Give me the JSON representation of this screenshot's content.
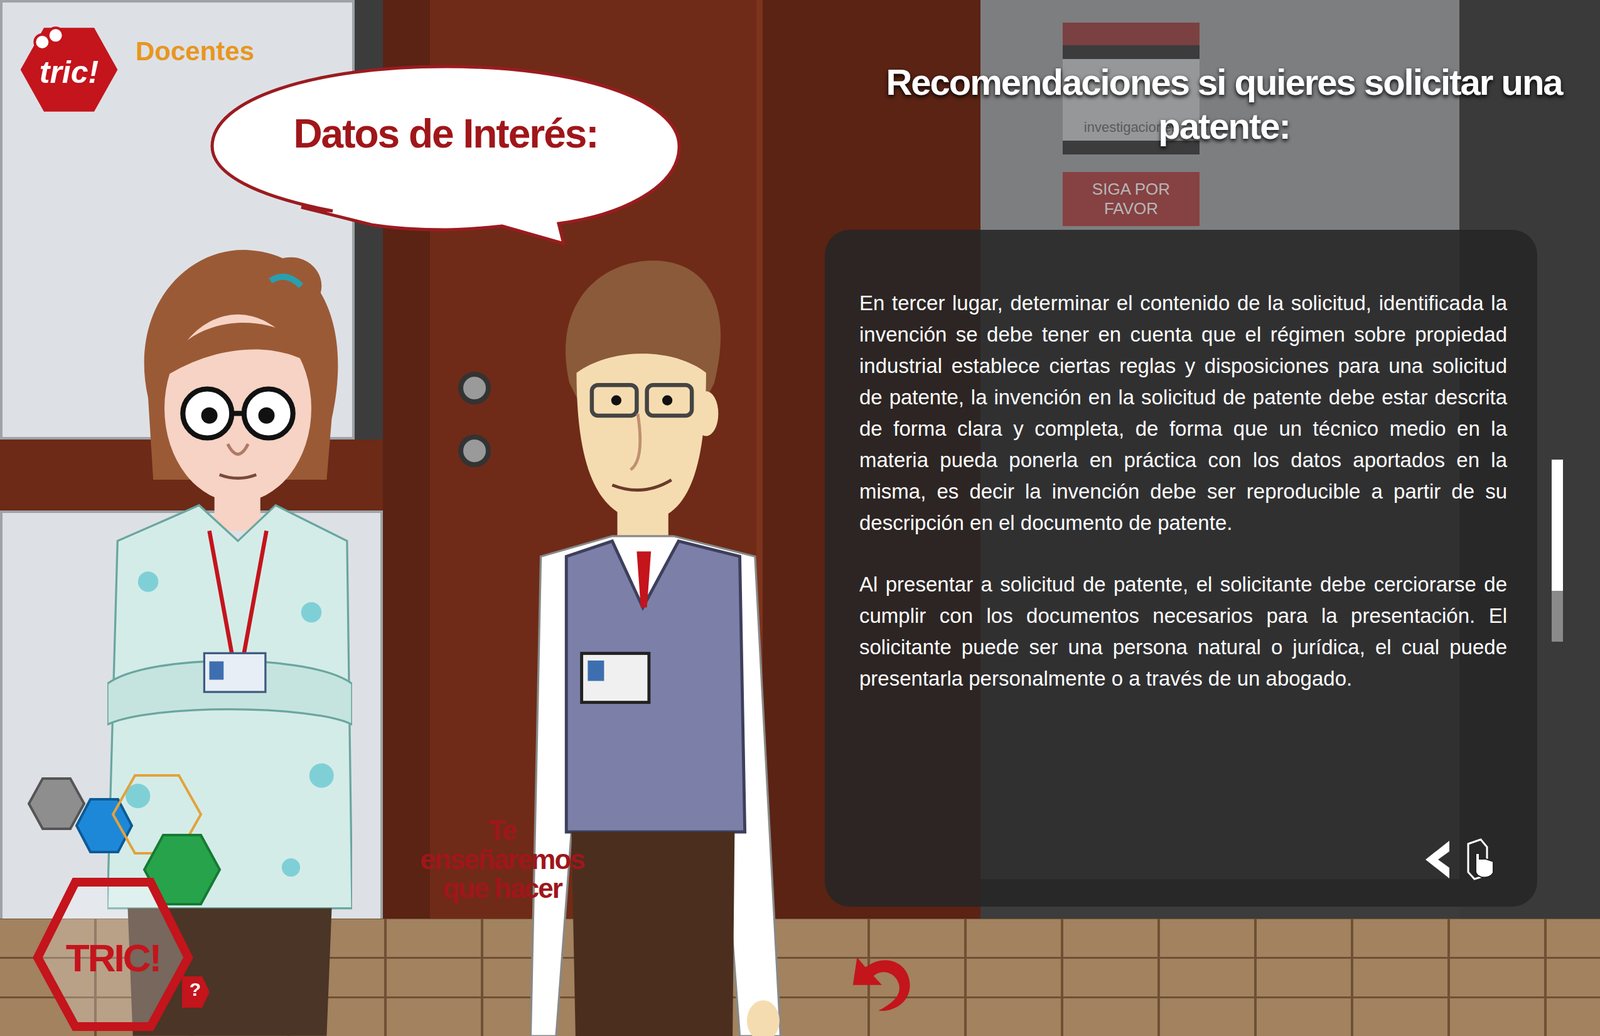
{
  "header": {
    "logo": "tric!",
    "section": "Docentes"
  },
  "speech_bubble": {
    "text": "Datos de Interés:"
  },
  "sign": {
    "text": "investigaciones",
    "button": "SIGA POR FAVOR"
  },
  "panel": {
    "title": "Recomendaciones si quieres solicitar una patente:",
    "paragraphs": [
      "En tercer lugar, determinar el contenido de la solicitud, identificada la invención se debe tener en cuenta que el régimen sobre propiedad industrial establece ciertas reglas y disposiciones para una solicitud de patente, la invención en la solicitud de patente debe estar descrita de forma clara y completa, de forma que un técnico medio en la materia pueda ponerla en práctica con los datos aportados en la misma, es decir la invención debe ser reproducible a partir de su descripción en el documento de patente.",
      "Al presentar a solicitud de patente, el solicitante debe cerciorarse de cumplir con los documentos necesarios para la presentación. El solicitante puede ser una persona natural o jurídica, el cual puede presentarla personalmente o a través de un abogado."
    ],
    "scrollbar": {
      "level": 0.72
    }
  },
  "caption": "Te enseñaremos que hacer",
  "menu": {
    "label": "TRIC!",
    "help": "?"
  }
}
